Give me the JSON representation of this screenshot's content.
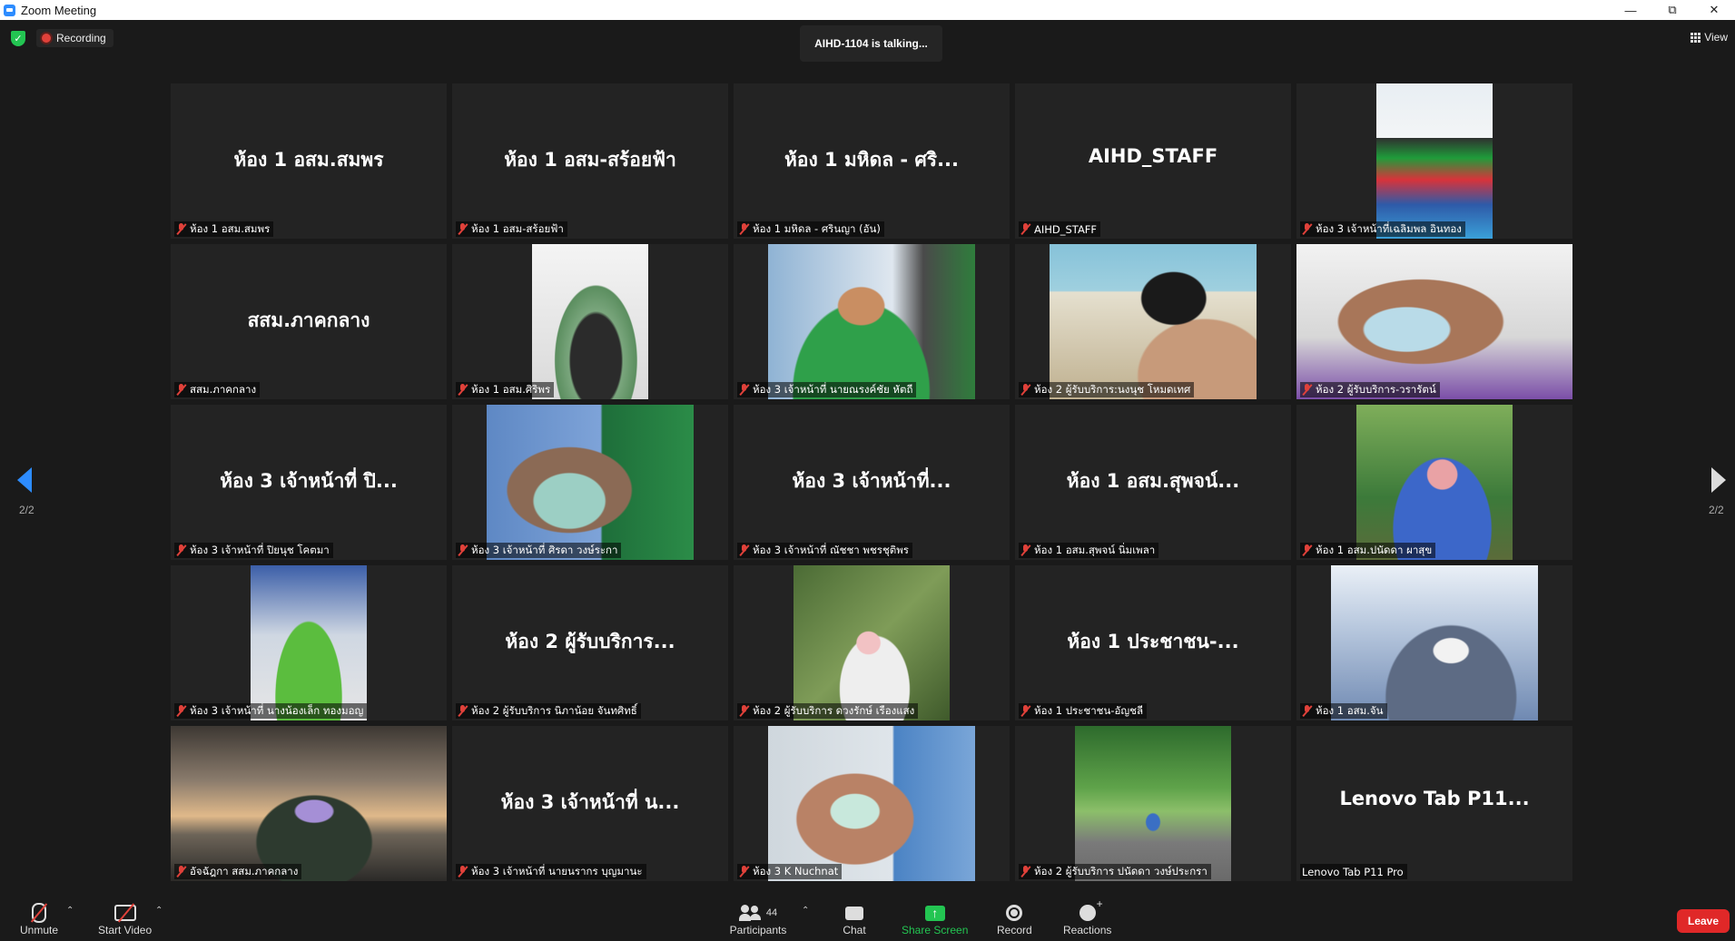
{
  "window": {
    "title": "Zoom Meeting"
  },
  "topbar": {
    "recording_label": "Recording",
    "talking_banner": "AIHD-1104 is talking...",
    "view_label": "View"
  },
  "nav": {
    "page_left": "2/2",
    "page_right": "2/2"
  },
  "tiles": [
    {
      "big": "ห้อง 1 อสม.สมพร",
      "label": "ห้อง 1 อสม.สมพร"
    },
    {
      "big": "ห้อง 1 อสม-สร้อยฟ้า",
      "label": "ห้อง 1 อสม-สร้อยฟ้า"
    },
    {
      "big": "ห้อง 1 มหิดล - ศริ...",
      "label": "ห้อง 1 มหิดล - ศรินญา (อัน)"
    },
    {
      "big": "AIHD_STAFF",
      "label": "AIHD_STAFF"
    },
    {
      "big": "",
      "label": "ห้อง 3 เจ้าหน้าที่เฉลิมพล อินทอง"
    },
    {
      "big": "สสม.ภาคกลาง",
      "label": "สสม.ภาคกลาง"
    },
    {
      "big": "",
      "label": "ห้อง 1 อสม.ศิริพร"
    },
    {
      "big": "",
      "label": "ห้อง 3 เจ้าหน้าที่ นายณรงค์ชัย หัตถี"
    },
    {
      "big": "",
      "label": "ห้อง 2 ผู้รับบริการ:นงนุช โหมดเทศ"
    },
    {
      "big": "",
      "label": "ห้อง 2 ผู้รับบริการ-วรารัตน์"
    },
    {
      "big": "ห้อง 3 เจ้าหน้าที่ ปิ...",
      "label": "ห้อง 3 เจ้าหน้าที่ ปิยนุช โคตมา"
    },
    {
      "big": "",
      "label": "ห้อง 3 เจ้าหน้าที่ ศิรดา วงษ์ระกา"
    },
    {
      "big": "ห้อง 3 เจ้าหน้าที่...",
      "label": "ห้อง 3 เจ้าหน้าที่ ณัชชา พชรชุติพร"
    },
    {
      "big": "ห้อง 1 อสม.สุพจน์...",
      "label": "ห้อง 1 อสม.สุพจน์ นิ่มเพลา"
    },
    {
      "big": "",
      "label": "ห้อง 1 อสม.ปนัดดา ผาสุข"
    },
    {
      "big": "",
      "label": "ห้อง 3 เจ้าหน้าที่ นางน้องเล็ก ทองมอญ"
    },
    {
      "big": "ห้อง 2 ผู้รับบริการ...",
      "label": "ห้อง 2 ผู้รับบริการ นิภาน้อย จันทศิทธิ์"
    },
    {
      "big": "",
      "label": "ห้อง 2 ผู้รับบริการ ดวงรักษ์ เรืองแสง"
    },
    {
      "big": "ห้อง 1 ประชาชน-...",
      "label": "ห้อง 1 ประชาชน-อัญชลี"
    },
    {
      "big": "",
      "label": "ห้อง 1 อสม.จัน"
    },
    {
      "big": "",
      "label": "อัจฉัฎกา สสม.ภาคกลาง"
    },
    {
      "big": "ห้อง 3 เจ้าหน้าที่ น...",
      "label": "ห้อง 3 เจ้าหน้าที่ นายนรากร บุญมานะ"
    },
    {
      "big": "",
      "label": "ห้อง 3 K Nuchnat"
    },
    {
      "big": "",
      "label": "ห้อง 2 ผู้รับบริการ ปนัดดา วงษ์ประกรา"
    },
    {
      "big": "Lenovo Tab P11...",
      "label": "Lenovo Tab P11 Pro"
    }
  ],
  "toolbar": {
    "unmute": "Unmute",
    "start_video": "Start Video",
    "participants": "Participants",
    "participants_count": "44",
    "chat": "Chat",
    "share_screen": "Share Screen",
    "record": "Record",
    "reactions": "Reactions",
    "leave": "Leave"
  },
  "colors": {
    "accent": "#2d8cff",
    "share": "#23c552",
    "leave": "#e02828",
    "muted": "#e0413a"
  }
}
